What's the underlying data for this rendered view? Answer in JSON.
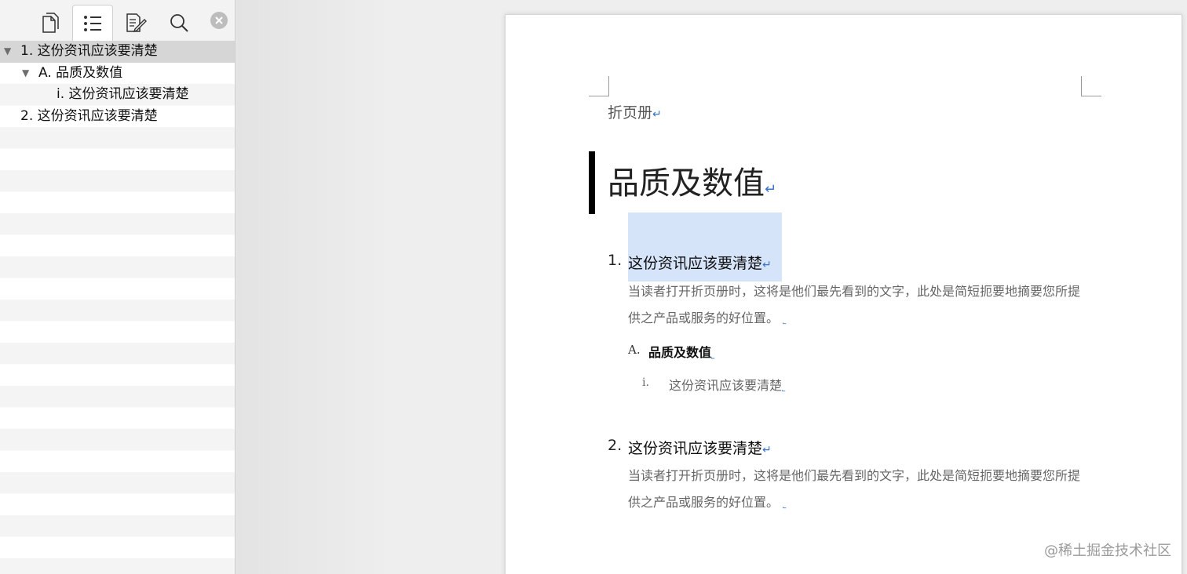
{
  "sidebar": {
    "tabs": [
      {
        "name": "pages-tab",
        "icon": "page-thumbnails-icon",
        "active": false
      },
      {
        "name": "outline-tab",
        "icon": "bullet-list-icon",
        "active": true
      },
      {
        "name": "review-tab",
        "icon": "document-edit-icon",
        "active": false
      },
      {
        "name": "search-tab",
        "icon": "search-icon",
        "active": false
      }
    ],
    "close_icon": "close-circle-icon",
    "outline": [
      {
        "label": "1. 这份资讯应该要清楚",
        "expanded": true,
        "selected": true
      },
      {
        "label": "A. 品质及数值",
        "expanded": true
      },
      {
        "label": "i. 这份资讯应该要清楚"
      },
      {
        "label": "2. 这份资讯应该要清楚"
      }
    ]
  },
  "document": {
    "header": "折页册",
    "title": "品质及数值",
    "paragraph_mark": "↵",
    "small_mark": "˾",
    "sections": [
      {
        "number": "1.",
        "heading": "这份资讯应该要清楚",
        "body_line1": "当读者打开折页册时，这将是他们最先看到的文字，此处是简短扼要地摘要您所提",
        "body_line2": "供之产品或服务的好位置。",
        "sub_letter": "A.",
        "sub_heading": "品质及数值",
        "subsub_numeral": "i.",
        "subsub_heading": "这份资讯应该要清楚"
      },
      {
        "number": "2.",
        "heading": "这份资讯应该要清楚",
        "body_line1": "当读者打开折页册时，这将是他们最先看到的文字，此处是简短扼要地摘要您所提",
        "body_line2": "供之产品或服务的好位置。"
      }
    ]
  },
  "watermark": "@稀土掘金技术社区",
  "colors": {
    "selection": "#d5e4f9",
    "paragraph_mark": "#3a74c9",
    "outline_selected": "#d6d6d6"
  }
}
